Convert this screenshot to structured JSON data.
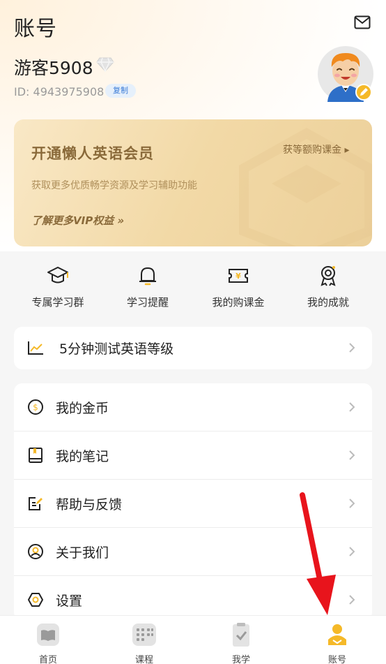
{
  "header": {
    "title": "账号"
  },
  "profile": {
    "name": "游客5908",
    "id_label": "ID: 4943975908",
    "copy_label": "复制"
  },
  "vip": {
    "title": "开通懒人英语会员",
    "link": "获等额购课金 ▸",
    "desc": "获取更多优质畅学资源及学习辅助功能",
    "more": "了解更多VIP权益 »"
  },
  "shortcuts": [
    {
      "label": "专属学习群",
      "icon": "graduation-cap-icon"
    },
    {
      "label": "学习提醒",
      "icon": "bell-icon"
    },
    {
      "label": "我的购课金",
      "icon": "ticket-icon"
    },
    {
      "label": "我的成就",
      "icon": "medal-icon"
    }
  ],
  "test": {
    "label": "5分钟测试英语等级",
    "icon": "chart-icon"
  },
  "menu": [
    {
      "label": "我的金币",
      "icon": "coin-icon"
    },
    {
      "label": "我的笔记",
      "icon": "notebook-icon"
    },
    {
      "label": "帮助与反馈",
      "icon": "edit-icon"
    },
    {
      "label": "关于我们",
      "icon": "user-circle-icon"
    },
    {
      "label": "设置",
      "icon": "hexagon-settings-icon"
    }
  ],
  "tabs": [
    {
      "label": "首页",
      "active": false
    },
    {
      "label": "课程",
      "active": false
    },
    {
      "label": "我学",
      "active": false
    },
    {
      "label": "账号",
      "active": true
    }
  ],
  "colors": {
    "accent": "#f5b928",
    "vip_text": "#8a6a3a",
    "annotation_arrow": "#e8141c"
  }
}
